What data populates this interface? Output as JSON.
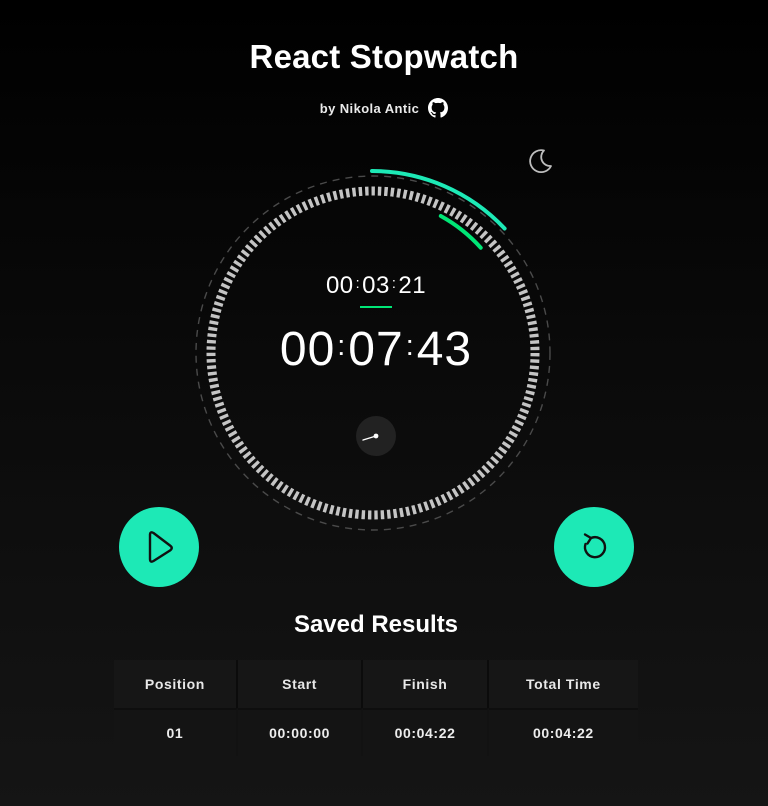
{
  "header": {
    "title": "React Stopwatch",
    "author": "by Nikola Antic"
  },
  "icons": {
    "github": "github-icon",
    "theme": "moon-icon",
    "play": "play-icon",
    "reset": "reset-icon"
  },
  "colors": {
    "accent": "#1de9b6",
    "lap_accent": "#00e676",
    "background": "#000000",
    "tick": "#bdbdbd"
  },
  "timer": {
    "lap": {
      "h": "00",
      "m": "03",
      "s": "21"
    },
    "main": {
      "h": "00",
      "m": "07",
      "s": "43"
    }
  },
  "saved": {
    "title": "Saved Results",
    "columns": [
      "Position",
      "Start",
      "Finish",
      "Total Time"
    ],
    "rows": [
      [
        "01",
        "00:00:00",
        "00:04:22",
        "00:04:22"
      ]
    ]
  }
}
